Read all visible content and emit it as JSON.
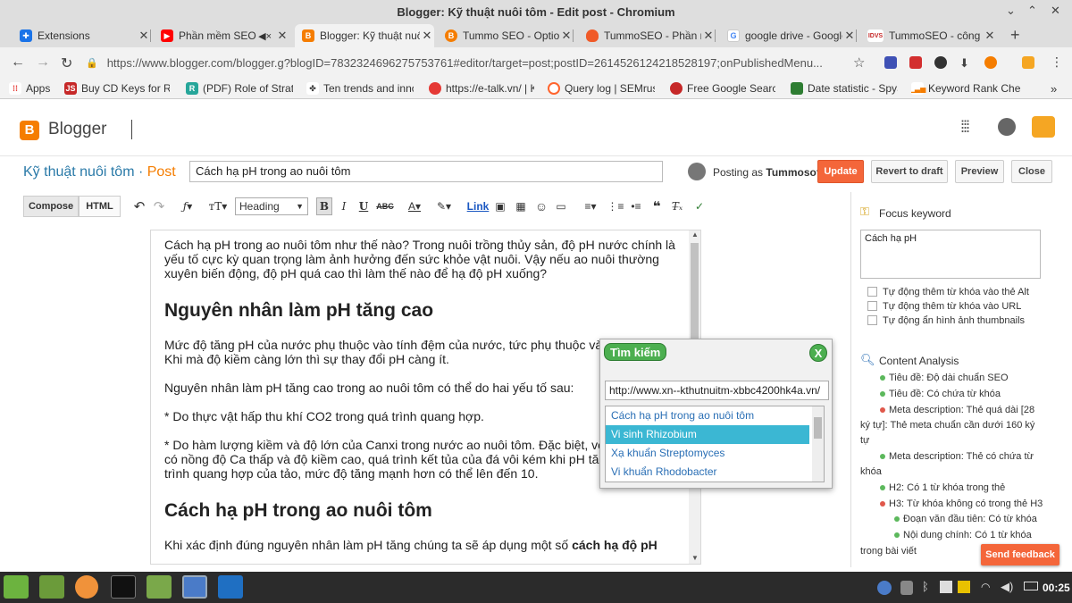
{
  "window": {
    "title": "Blogger: Kỹ thuật nuôi tôm - Edit post - Chromium"
  },
  "tabs": [
    {
      "label": "Extensions",
      "fav": "puzzle-icon",
      "color": "#1a73e8"
    },
    {
      "label": "Phần mềm SEO Tum",
      "fav": "youtube-icon",
      "color": "#ff0000"
    },
    {
      "label": "Blogger: Kỹ thuật nuôi",
      "fav": "blogger-icon",
      "color": "#f57d00"
    },
    {
      "label": "Tummo SEO - Options",
      "fav": "blogger-icon",
      "color": "#f57d00"
    },
    {
      "label": "TummoSEO - Phần m",
      "fav": "flame-icon",
      "color": "#f05a28"
    },
    {
      "label": "google drive - Google",
      "fav": "google-icon",
      "color": "#4285f4"
    },
    {
      "label": "TummoSEO - công c",
      "fav": "idvs-icon",
      "color": "#c62828"
    }
  ],
  "nav": {
    "url": "https://www.blogger.com/blogger.g?blogID=7832324696275753761#editor/target=post;postID=2614526124218528197;onPublishedMenu..."
  },
  "bookmarks": [
    {
      "label": "Apps"
    },
    {
      "label": "Buy CD Keys for Retai"
    },
    {
      "label": "(PDF) Role of Strateg"
    },
    {
      "label": "Ten trends and innov"
    },
    {
      "label": "https://e-talk.vn/ | K"
    },
    {
      "label": "Query log | SEMrush"
    },
    {
      "label": "Free Google Search"
    },
    {
      "label": "Date statistic - SpyS"
    },
    {
      "label": "Keyword Rank Check"
    }
  ],
  "blogger": {
    "name": "Blogger"
  },
  "post": {
    "blog_title": "Kỹ thuật nuôi tôm",
    "sep": " · ",
    "post_label": "Post",
    "title_value": "Cách hạ pH trong ao nuôi tôm",
    "posting_as": "Posting as",
    "user": "Tummosoft",
    "update": "Update",
    "revert": "Revert to draft",
    "preview": "Preview",
    "close": "Close"
  },
  "toolbar": {
    "compose": "Compose",
    "html": "HTML",
    "heading": "Heading",
    "link": "Link"
  },
  "editor": {
    "p1": "Cách hạ pH trong ao nuôi tôm như thế nào? Trong nuôi trồng thủy sản, độ pH nước chính là yếu tố cực kỳ quan trọng làm ảnh hưởng đến sức khỏe vật nuôi. Vậy nếu ao nuôi thường xuyên biến động, độ pH quá cao thì làm thế nào để hạ độ pH xuống?",
    "h1": "Nguyên nhân làm pH tăng cao",
    "p2": "Mức độ tăng pH của nước phụ thuộc vào tính đệm của nước, tức phụ thuộc vào độ kiềm. Khi mà độ kiềm càng lớn thì sự thay đổi pH càng ít.",
    "p3": "Nguyên nhân làm pH tăng cao trong ao nuôi tôm có thể do hai yếu tố sau:",
    "p4": "* Do thực vật hấp thu khí CO2 trong quá trình quang hợp.",
    "p5": "* Do hàm lượng kiềm và độ lớn của Canxi trong nước ao nuôi tôm. Đặc biệt, với những ao có nồng độ Ca thấp và độ kiềm cao, quá trình kết tủa của đá vôi kém khi pH tăng. Khi quá trình quang hợp của tảo, mức độ tăng mạnh hơn có thể lên đến 10.",
    "h2": "Cách hạ pH trong ao nuôi tôm",
    "p6": "Khi xác định đúng nguyên nhân làm pH tăng chúng ta sẽ áp dụng một số ",
    "p6b": "cách hạ độ pH"
  },
  "popup": {
    "title": "Tìm kiếm",
    "close": "X",
    "url": "http://www.xn--kthutnuitm-xbbc4200hk4a.vn/",
    "items": [
      "Cách hạ pH trong ao nuôi tôm",
      "Vi sinh Rhizobium",
      "Xạ khuẩn Streptomyces",
      "Vi khuẩn Rhodobacter"
    ]
  },
  "side": {
    "focus_label": "Focus keyword",
    "focus_value": "Cách hạ pH",
    "opt1": "Tự động thêm từ khóa vào thẻ Alt",
    "opt2": "Tự động thêm từ khóa vào URL",
    "opt3": "Tự động ẩn hình ảnh thumbnails",
    "analysis_label": "Content Analysis",
    "a1": "Tiêu đề: Độ dài chuẩn SEO",
    "a2": "Tiêu đề: Có chứa từ khóa",
    "a3a": "Meta description: Thẻ quá dài [28",
    "a3b": "ký tự]: Thẻ meta chuẩn cần dưới 160 ký",
    "a3c": "tự",
    "a4a": "Meta description: Thẻ có chứa từ",
    "a4b": "khóa",
    "a5": "H2: Có 1 từ khóa trong thẻ",
    "a6": "H3: Từ khóa không có trong thẻ H3",
    "a7": "Đoạn văn đầu tiên: Có từ khóa",
    "a8a": "Nội dung chính: Có 1 từ khóa",
    "a8b": "trong bài viết",
    "feedback": "Send feedback"
  },
  "taskbar": {
    "clock": "00:25"
  },
  "colors": {
    "green": "#5cb85c",
    "red": "#e0584b",
    "accent": "#f57d00"
  }
}
